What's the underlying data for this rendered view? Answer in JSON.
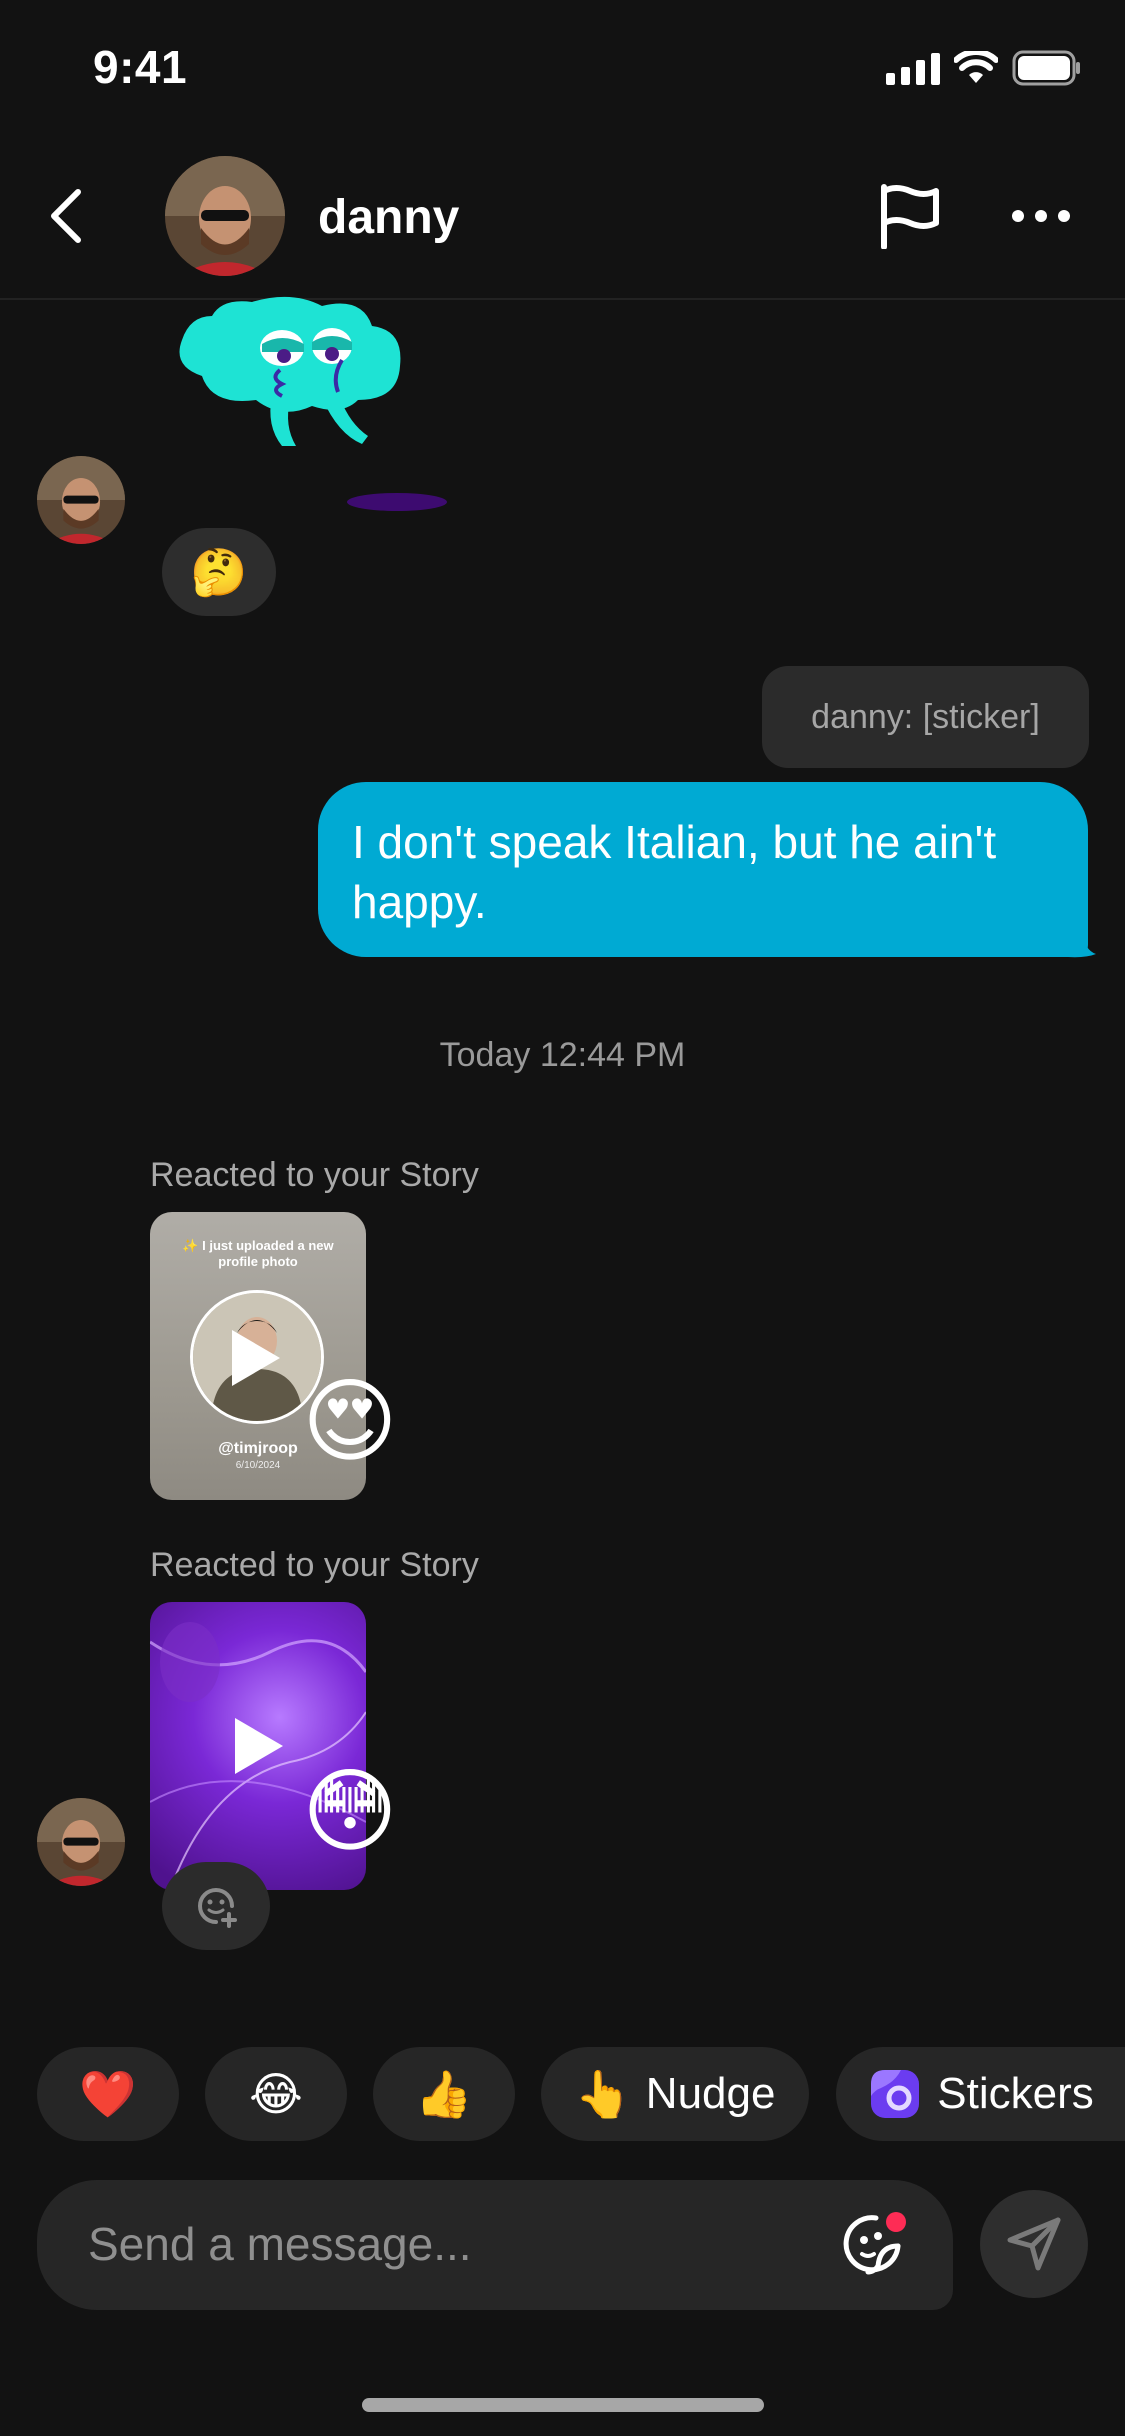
{
  "status_bar": {
    "time": "9:41"
  },
  "header": {
    "contact_name": "danny"
  },
  "messages": {
    "think_reaction": "🤔",
    "quoted_text": "danny: [sticker]",
    "my_message": "I don't speak Italian, but he ain't happy.",
    "timestamp": "Today 12:44 PM",
    "story_reactions": [
      {
        "label": "Reacted to your Story",
        "caption": "✨ I just uploaded a new profile photo",
        "handle": "@timjroop",
        "date": "6/10/2024",
        "emoji": "😍"
      },
      {
        "label": "Reacted to your Story",
        "emoji": "😳"
      }
    ]
  },
  "quick_reactions": [
    {
      "emoji": "❤️",
      "label": ""
    },
    {
      "emoji": "😂",
      "label": ""
    },
    {
      "emoji": "👍",
      "label": ""
    },
    {
      "emoji": "👆",
      "label": "Nudge"
    },
    {
      "emoji": "",
      "label": "Stickers"
    }
  ],
  "composer": {
    "placeholder": "Send a message..."
  },
  "colors": {
    "background": "#121212",
    "my_bubble": "#00aad3",
    "pill": "#262626",
    "badge": "#fe2c55"
  },
  "icons": [
    "back-icon",
    "flag-icon",
    "more-icon",
    "play-icon",
    "sticker-add-icon",
    "sticker-face-icon",
    "send-icon",
    "stickers-icon"
  ]
}
